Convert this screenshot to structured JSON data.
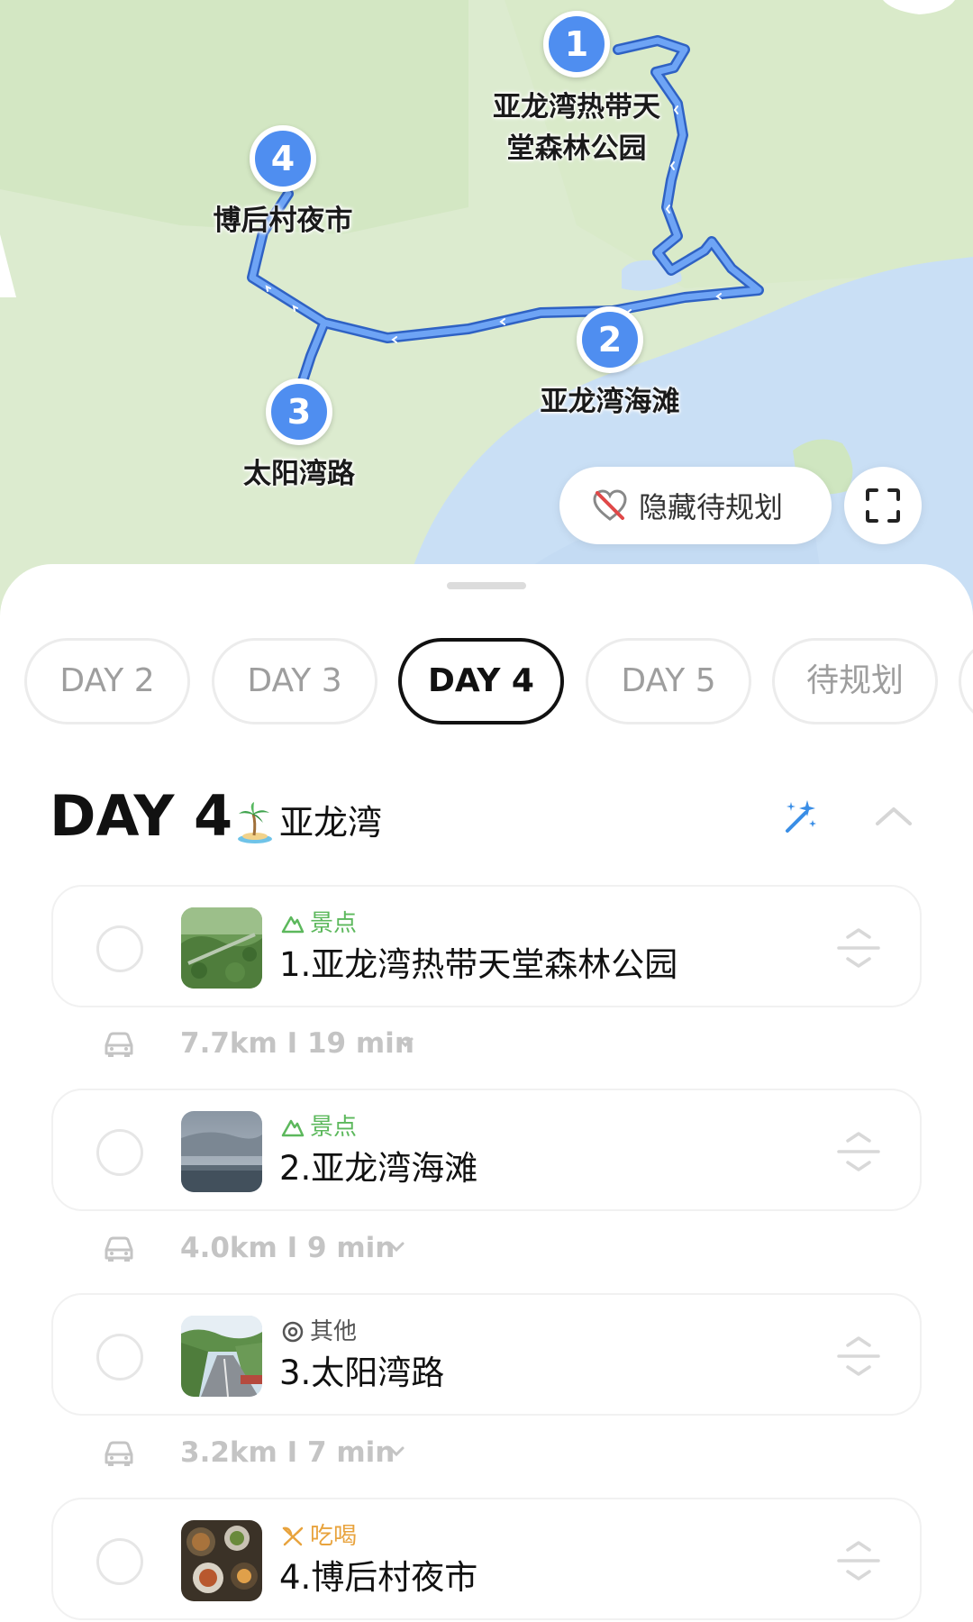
{
  "map": {
    "markers": [
      {
        "number": "1",
        "label": "亚龙湾热带天\n堂森林公园"
      },
      {
        "number": "2",
        "label": "亚龙湾海滩"
      },
      {
        "number": "3",
        "label": "太阳湾路"
      },
      {
        "number": "4",
        "label": "博后村夜市"
      }
    ],
    "hide_pending_label": "隐藏待规划",
    "hide_pending_icon": "heart-slash-icon",
    "fullscreen_icon": "fullscreen-icon",
    "colors": {
      "land": "#dcebcf",
      "water": "#c9dff5",
      "route": "#4f8ef0",
      "route_outline": "#2f62c4"
    }
  },
  "day_tabs": [
    {
      "label": "DAY 2",
      "active": false
    },
    {
      "label": "DAY 3",
      "active": false
    },
    {
      "label": "DAY 4",
      "active": true
    },
    {
      "label": "DAY 5",
      "active": false
    },
    {
      "label": "待规划",
      "active": false
    }
  ],
  "day": {
    "title": "DAY 4",
    "place": "亚龙湾",
    "place_icon": "palm-island-icon",
    "actions": [
      "magic-wand-icon",
      "collapse-icon"
    ]
  },
  "items": [
    {
      "category": "景点",
      "category_icon": "mountain-icon",
      "category_color": "#5cb85c",
      "name": "1.亚龙湾热带天堂森林公园",
      "thumb": "forest-photo"
    },
    {
      "category": "景点",
      "category_icon": "mountain-icon",
      "category_color": "#5cb85c",
      "name": "2.亚龙湾海滩",
      "thumb": "beach-photo"
    },
    {
      "category": "其他",
      "category_icon": "location-pin-icon",
      "category_color": "#555555",
      "name": "3.太阳湾路",
      "thumb": "road-photo"
    },
    {
      "category": "吃喝",
      "category_icon": "utensils-icon",
      "category_color": "#e8a33d",
      "name": "4.博后村夜市",
      "thumb": "food-photo"
    }
  ],
  "routes": [
    {
      "text": "7.7km Ι 19 min",
      "icon": "car-icon"
    },
    {
      "text": "4.0km Ι 9 min",
      "icon": "car-icon"
    },
    {
      "text": "3.2km Ι 7 min",
      "icon": "car-icon"
    }
  ]
}
